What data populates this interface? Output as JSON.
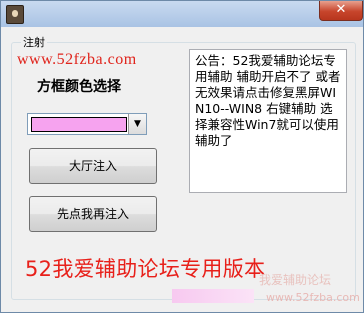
{
  "titlebar": {
    "close_glyph": "✕"
  },
  "group": {
    "title": "注射"
  },
  "site_url": "www.52fzba.com",
  "color": {
    "title": "方框颜色选择",
    "selected": "#f6a3ef",
    "drop_glyph": "▼"
  },
  "buttons": {
    "hall": "大厅注入",
    "first": "先点我再注入"
  },
  "notice": "公告：52我爱辅助论坛专用辅助 辅助开启不了 或者无效果请点击修复黑屏WIN10--WIN8 右键辅助 选择兼容性Win7就可以使用辅助了",
  "banner": "52我爱辅助论坛专用版本",
  "watermark": {
    "logo": "我爱辅助论坛",
    "url": "www.52fzba.com"
  },
  "icons": {
    "app": "app-icon",
    "close": "close-icon",
    "dropdown": "chevron-down-icon"
  }
}
